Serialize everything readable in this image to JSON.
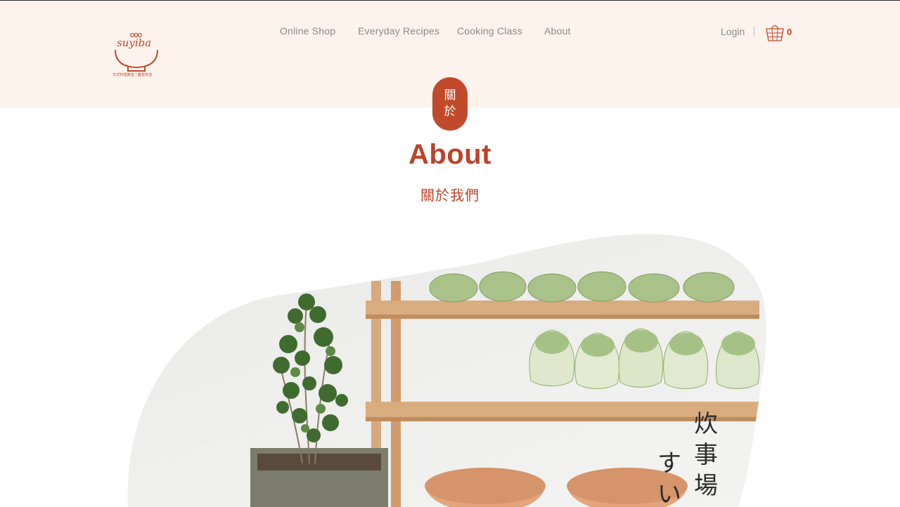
{
  "brand": {
    "name": "suyiba",
    "tagline": "日式料理教室 | 雜貨商店",
    "accent_color": "#c04a2e",
    "header_bg": "#fdf3ec"
  },
  "nav": {
    "items": [
      {
        "label": "Online Shop"
      },
      {
        "label": "Everyday Recipes"
      },
      {
        "label": "Cooking Class"
      },
      {
        "label": "About"
      }
    ],
    "login_label": "Login",
    "divider": "|",
    "cart_icon": "basket-icon",
    "cart_count": "0"
  },
  "hero_badge": {
    "line1": "關",
    "line2": "於"
  },
  "page": {
    "title": "About",
    "subtitle": "關於我們"
  },
  "hero_image": {
    "description_icon": "kitchen-shelf-photo",
    "vertical_text_right": [
      "炊",
      "事",
      "場"
    ],
    "vertical_text_left": [
      "す",
      "い"
    ]
  }
}
